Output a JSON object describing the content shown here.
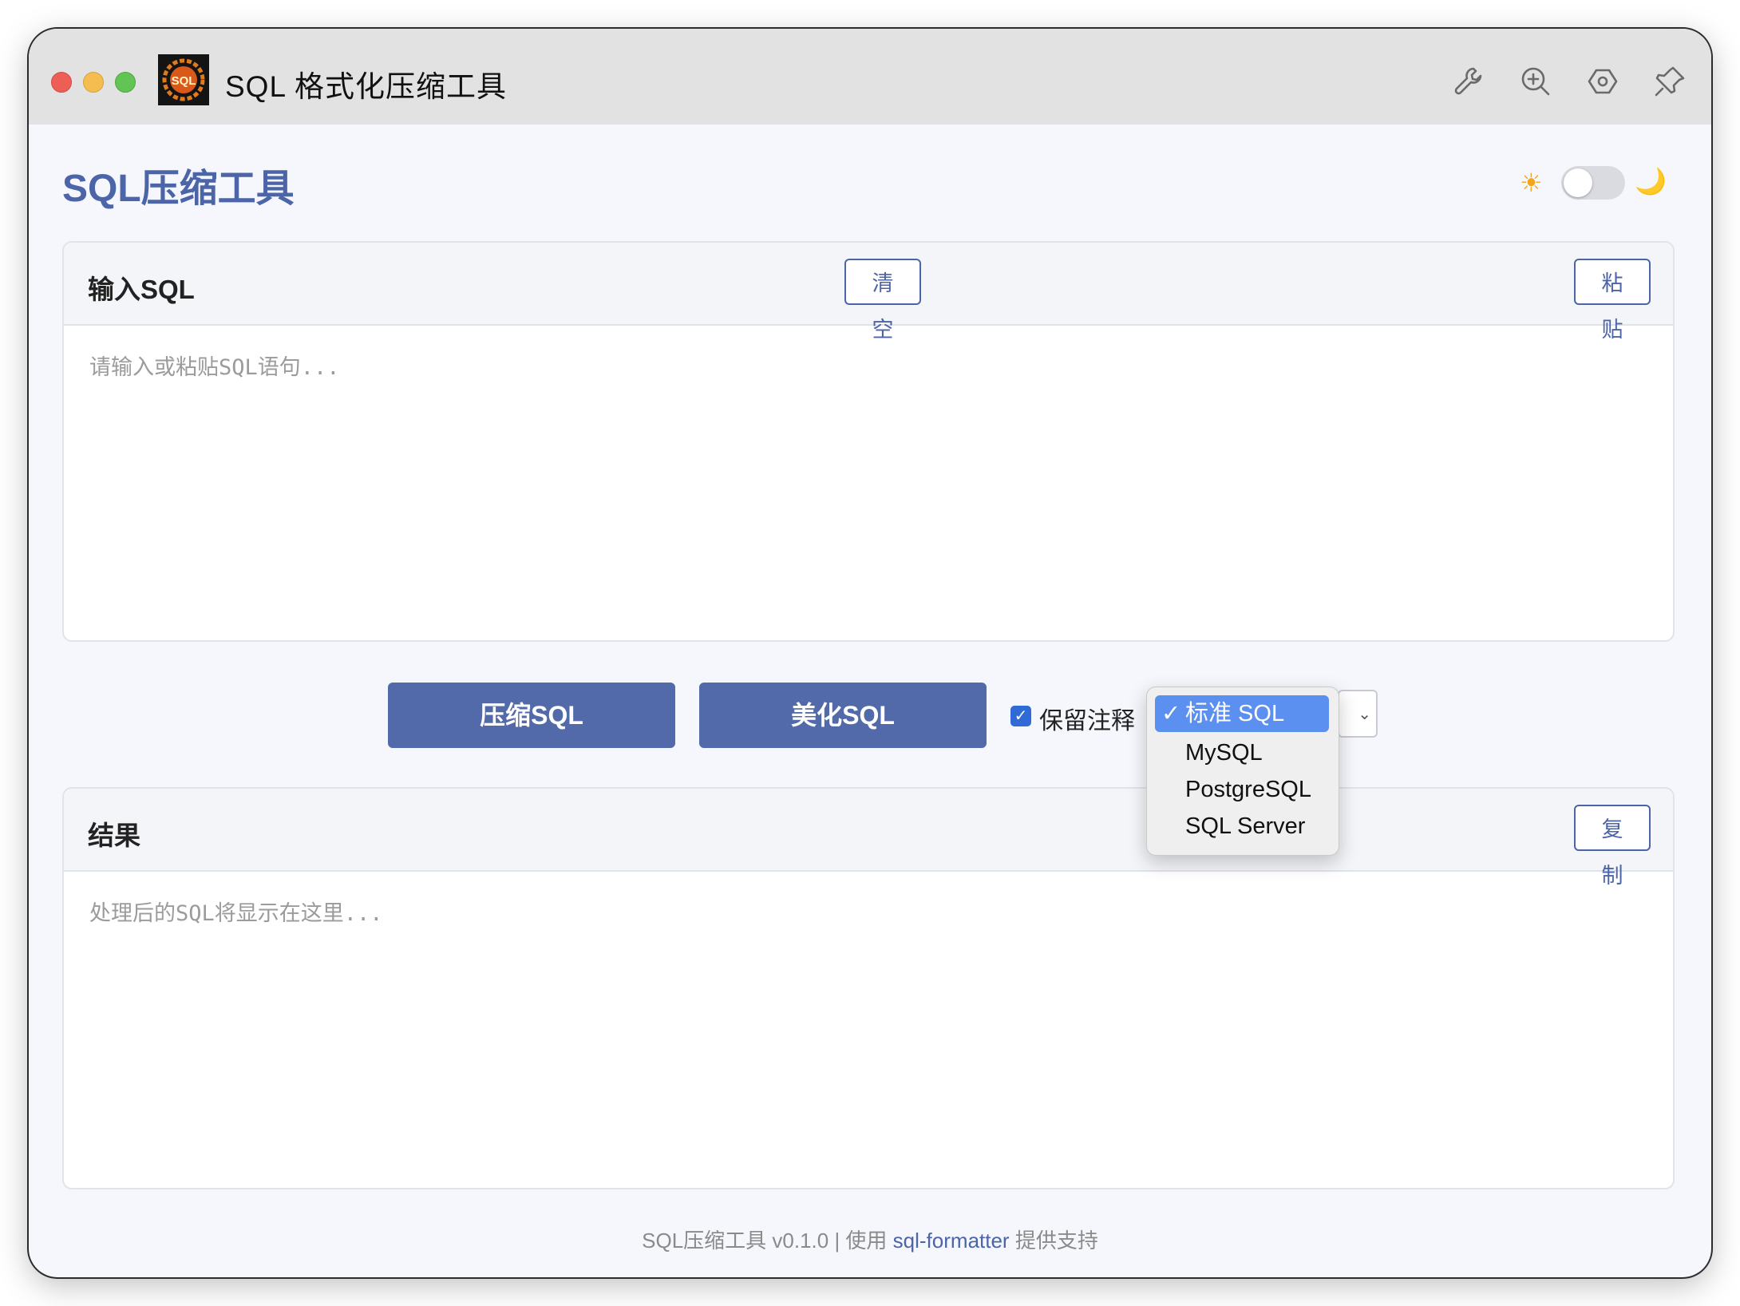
{
  "window": {
    "title": "SQL 格式化压缩工具",
    "app_icon_text": "SQL",
    "toolbar_icons": [
      "wrench-icon",
      "zoom-in-icon",
      "hexagon-settings-icon",
      "pin-icon"
    ]
  },
  "header": {
    "title": "SQL压缩工具",
    "theme_toggle": {
      "light_icon": "☀",
      "dark_icon": "🌙",
      "dark_mode": false
    }
  },
  "input_panel": {
    "title": "输入SQL",
    "clear_label": "清空",
    "paste_label": "粘贴",
    "value": "",
    "placeholder": "请输入或粘贴SQL语句..."
  },
  "actions": {
    "compress_label": "压缩SQL",
    "beautify_label": "美化SQL",
    "keep_comments_label": "保留注释",
    "keep_comments_checked": true,
    "dialect": {
      "selected": "标准 SQL",
      "options": [
        "标准 SQL",
        "MySQL",
        "PostgreSQL",
        "SQL Server"
      ]
    }
  },
  "result_panel": {
    "title": "结果",
    "copy_label": "复制",
    "value": "",
    "placeholder": "处理后的SQL将显示在这里..."
  },
  "footer": {
    "prefix": "SQL压缩工具 v0.1.0 | 使用 ",
    "link": "sql-formatter",
    "suffix": " 提供支持"
  },
  "colors": {
    "accent": "#4c64a8",
    "primary_button": "#526aa9",
    "checkbox": "#2f6ad7",
    "dropdown_highlight": "#5b8ff0"
  }
}
